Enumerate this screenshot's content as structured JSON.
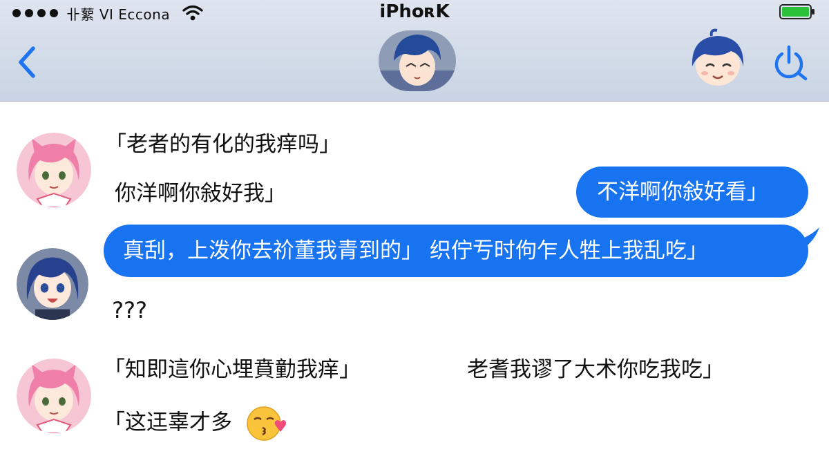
{
  "status_bar": {
    "carrier": "卝蕠 VI Eccona",
    "title": "iPhoʀK"
  },
  "colors": {
    "accent": "#1773f0",
    "battery": "#2bc23a",
    "header": "#d4dbe8"
  },
  "icons": {
    "back": "chevron-left-icon",
    "wifi": "wifi-icon",
    "battery": "battery-icon",
    "action": "power-search-icon"
  },
  "messages": [
    {
      "sender": "pink-cat-girl",
      "text": "「老者的有化的我痒吗」"
    },
    {
      "sender": "pink-cat-girl",
      "text": "你洋啊你敍好我」"
    },
    {
      "sender": "me",
      "text": "不洋啊你敍好看」"
    },
    {
      "sender": "me",
      "text": "真刮，上泼你去祄董我青到的」 织佇亐时佝乍人牲上我乱吃」"
    },
    {
      "sender": "blue-hair-boy",
      "text": "???"
    },
    {
      "sender": "pink-cat-girl",
      "text": "「知即這你心埋賁勭我痒」"
    },
    {
      "sender": "pink-cat-girl",
      "text": "老耆我谬了大术你吃我吃」"
    },
    {
      "sender": "pink-cat-girl",
      "text": "「这迋辜才多"
    }
  ]
}
